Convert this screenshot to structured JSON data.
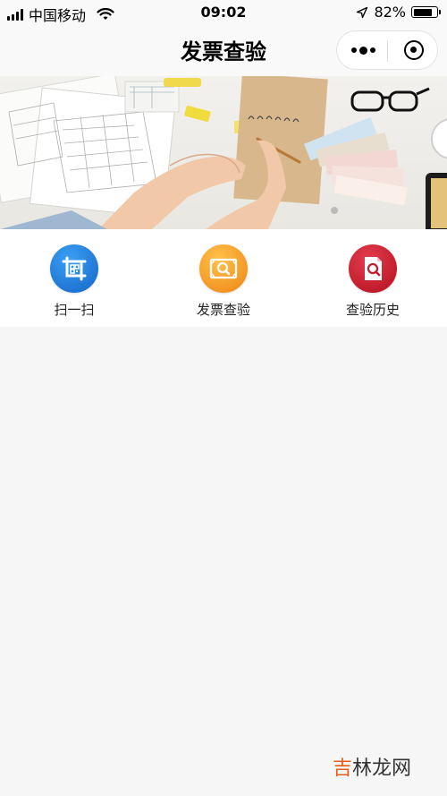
{
  "status_bar": {
    "carrier": "中国移动",
    "time": "09:02",
    "battery_percent": "82%",
    "battery_level": 0.82,
    "icons": [
      "signal-icon",
      "wifi-icon",
      "location-arrow-icon",
      "battery-icon"
    ]
  },
  "nav": {
    "title": "发票查验",
    "icons": [
      "more-dots-icon",
      "close-target-icon"
    ]
  },
  "banner": {
    "image_description": ""
  },
  "menu": {
    "items": [
      {
        "label": "扫一扫",
        "icon": "scan-icon",
        "color": "#1a78d6"
      },
      {
        "label": "发票查验",
        "icon": "invoice-check-icon",
        "color": "#f39a1c"
      },
      {
        "label": "查验历史",
        "icon": "history-document-icon",
        "color": "#c9192c"
      }
    ]
  },
  "watermark": {
    "text": "吉林龙网",
    "accent_char": "吉",
    "rest": "林龙网"
  },
  "colors": {
    "background": "#f6f6f6",
    "scan_blue": "#1a78d6",
    "invoice_orange": "#f39a1c",
    "history_red": "#c9192c",
    "watermark_orange": "#e85d1a"
  }
}
